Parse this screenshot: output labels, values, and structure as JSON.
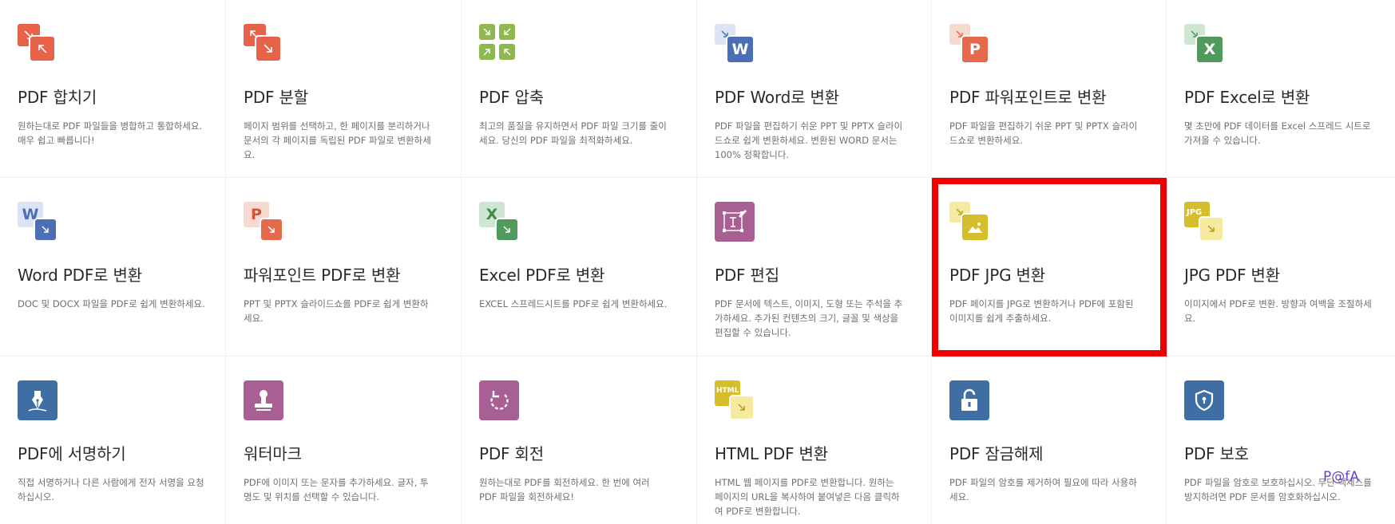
{
  "tools": [
    {
      "title": "PDF 합치기",
      "desc": "원하는대로 PDF 파일들을 병합하고 통합하세요. 매우 쉽고 빠릅니다!"
    },
    {
      "title": "PDF 분할",
      "desc": "페이지 범위를 선택하고, 한 페이지를 분리하거나 문서의 각 페이지를 독립된 PDF 파일로 변환하세요."
    },
    {
      "title": "PDF 압축",
      "desc": "최고의 품질을 유지하면서 PDF 파일 크기를 줄이세요. 당신의 PDF 파일을 최적화하세요."
    },
    {
      "title": "PDF Word로 변환",
      "desc": "PDF 파일을 편집하기 쉬운 PPT 및 PPTX 슬라이드쇼로 쉽게 변환하세요. 변환된 WORD 문서는 100% 정확합니다."
    },
    {
      "title": "PDF 파워포인트로 변환",
      "desc": "PDF 파일을 편집하기 쉬운 PPT 및 PPTX 슬라이드쇼로 변환하세요."
    },
    {
      "title": "PDF Excel로 변환",
      "desc": "몇 초만에 PDF 데이터를 Excel 스프레드 시트로 가져올 수 있습니다."
    },
    {
      "title": "Word PDF로 변환",
      "desc": "DOC 및 DOCX 파일을 PDF로 쉽게 변환하세요."
    },
    {
      "title": "파워포인트 PDF로 변환",
      "desc": "PPT 및 PPTX 슬라이드쇼를 PDF로 쉽게 변환하세요."
    },
    {
      "title": "Excel PDF로 변환",
      "desc": "EXCEL 스프레드시트를 PDF로 쉽게 변환하세요."
    },
    {
      "title": "PDF 편집",
      "desc": "PDF 문서에 텍스트, 이미지, 도형 또는 주석을 추가하세요. 추가된 컨텐츠의 크기, 글꼴 및 색상을 편집할 수 있습니다."
    },
    {
      "title": "PDF JPG 변환",
      "desc": "PDF 페이지를 JPG로 변환하거나 PDF에 포함된 이미지를 쉽게 추출하세요."
    },
    {
      "title": "JPG PDF 변환",
      "desc": "이미지에서 PDF로 변환. 방향과 여백을 조절하세요."
    },
    {
      "title": "PDF에 서명하기",
      "desc": "직접 서명하거나 다른 사람에게 전자 서명을 요청하십시오."
    },
    {
      "title": "워터마크",
      "desc": "PDF에 이미지 또는 문자를 추가하세요. 글자, 투명도 및 위치를 선택할 수 있습니다."
    },
    {
      "title": "PDF 회전",
      "desc": "원하는대로 PDF를 회전하세요. 한 번에 여러 PDF 파일을 회전하세요!"
    },
    {
      "title": "HTML PDF 변환",
      "desc": "HTML 웹 페이지를 PDF로 변환합니다. 원하는 페이지의 URL을 복사하여 붙여넣은 다음 클릭하여 PDF로 변환합니다."
    },
    {
      "title": "PDF 잠금해제",
      "desc": "PDF 파일의 암호를 제거하여 필요에 따라 사용하세요."
    },
    {
      "title": "PDF 보호",
      "desc": "PDF 파일을 암호로 보호하십시오. 무단 액세스를 방지하려면 PDF 문서를 암호화하십시오."
    }
  ],
  "icons": {
    "word_letter": "W",
    "ppt_letter": "P",
    "excel_letter": "X",
    "jpg_tag": "JPG",
    "html_tag": "HTML"
  },
  "colors": {
    "merge_split": "#e8624a",
    "compress": "#8fb850",
    "word": "#4a6fb5",
    "ppt": "#e5694a",
    "excel": "#509a5c",
    "edit": "#a85f94",
    "jpg": "#d6bd2c",
    "security": "#3f6ea4",
    "highlight": "#ee0000"
  },
  "watermark": "P@fA"
}
